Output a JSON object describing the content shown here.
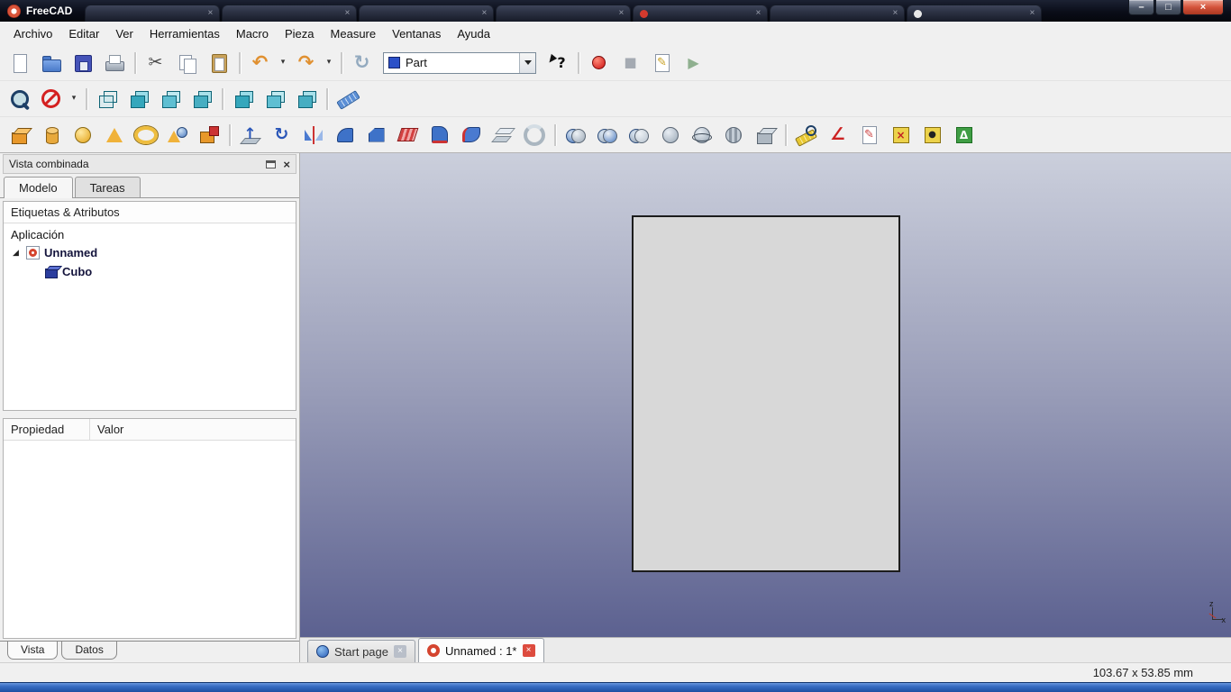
{
  "window": {
    "title": "FreeCAD",
    "controls": {
      "minimize": "–",
      "maximize": "□",
      "close": "×"
    },
    "ghost_tabs": [
      {
        "close": "×"
      },
      {
        "close": "×"
      },
      {
        "close": "×"
      },
      {
        "close": "×"
      },
      {
        "close": "×",
        "favstyle": "background:#d43a2e"
      },
      {
        "close": "×"
      },
      {
        "close": "×",
        "favstyle": "background:#e8e8e8"
      }
    ]
  },
  "menubar": {
    "items": [
      {
        "label": "Archivo",
        "name": "menu-archivo"
      },
      {
        "label": "Editar",
        "name": "menu-editar"
      },
      {
        "label": "Ver",
        "name": "menu-ver"
      },
      {
        "label": "Herramientas",
        "name": "menu-herramientas"
      },
      {
        "label": "Macro",
        "name": "menu-macro"
      },
      {
        "label": "Pieza",
        "name": "menu-pieza"
      },
      {
        "label": "Measure",
        "name": "menu-measure"
      },
      {
        "label": "Ventanas",
        "name": "menu-ventanas"
      },
      {
        "label": "Ayuda",
        "name": "menu-ayuda"
      }
    ]
  },
  "toolbars": {
    "workbench": {
      "value": "Part"
    },
    "row1a": [
      {
        "name": "new-file-button",
        "icon": "new-file-icon",
        "wcls": "tbtn",
        "cls": "tbi s-page",
        "glyph": "",
        "style": "",
        "inter": "true"
      },
      {
        "name": "open-file-button",
        "icon": "open-folder-icon",
        "wcls": "tbtn",
        "cls": "tbi s-folder",
        "glyph": "",
        "style": "",
        "inter": "true"
      },
      {
        "name": "save-button",
        "icon": "save-icon",
        "wcls": "tbtn",
        "cls": "tbi s-save",
        "glyph": "",
        "style": "",
        "inter": "true"
      },
      {
        "name": "print-button",
        "icon": "print-icon",
        "wcls": "tbtn",
        "cls": "tbi s-print",
        "glyph": "",
        "style": "",
        "inter": "true"
      },
      {
        "name": "toolbar-separator",
        "icon": "separator-line",
        "wcls": "tsepw",
        "cls": "tsep",
        "glyph": "",
        "style": "",
        "inter": "false"
      },
      {
        "name": "cut-button",
        "icon": "scissors-icon",
        "wcls": "tbtn",
        "cls": "tbi",
        "glyph": "✂",
        "style": "color:#4a4a4a;font-size:19px",
        "inter": "true"
      },
      {
        "name": "copy-button",
        "icon": "copy-icon",
        "wcls": "tbtn",
        "cls": "tbi s-copy",
        "glyph": "",
        "style": "",
        "inter": "true"
      },
      {
        "name": "paste-button",
        "icon": "paste-icon",
        "wcls": "tbtn",
        "cls": "tbi s-paste",
        "glyph": "",
        "style": "",
        "inter": "true"
      },
      {
        "name": "toolbar-separator",
        "icon": "separator-line",
        "wcls": "tsepw",
        "cls": "tsep",
        "glyph": "",
        "style": "",
        "inter": "false"
      },
      {
        "name": "undo-button",
        "icon": "undo-icon",
        "wcls": "tbtn",
        "cls": "tbi",
        "glyph": "↶",
        "style": "color:#e09030;font-size:21px;font-weight:bold",
        "inter": "true"
      },
      {
        "name": "undo-dropdown",
        "icon": "chevron-down-icon",
        "wcls": "tbtn narrow",
        "cls": "tbi s-dd",
        "glyph": "▾",
        "style": "",
        "inter": "true"
      },
      {
        "name": "redo-button",
        "icon": "redo-icon",
        "wcls": "tbtn",
        "cls": "tbi",
        "glyph": "↷",
        "style": "color:#e09030;font-size:21px;font-weight:bold",
        "inter": "true"
      },
      {
        "name": "redo-dropdown",
        "icon": "chevron-down-icon",
        "wcls": "tbtn narrow",
        "cls": "tbi s-dd",
        "glyph": "▾",
        "style": "",
        "inter": "true"
      },
      {
        "name": "toolbar-separator",
        "icon": "separator-line",
        "wcls": "tsepw",
        "cls": "tsep",
        "glyph": "",
        "style": "",
        "inter": "false"
      },
      {
        "name": "refresh-button",
        "icon": "refresh-icon",
        "wcls": "tbtn",
        "cls": "tbi",
        "glyph": "↻",
        "style": "color:#93aabf;font-size:21px;font-weight:bold",
        "inter": "true"
      }
    ],
    "row1b": [
      {
        "name": "whats-this-button",
        "icon": "help-cursor-icon",
        "wcls": "tbtn",
        "cls": "tbi s-what",
        "glyph": "?",
        "style": "color:#101010;font-weight:bold;font-size:16px",
        "inter": "true"
      },
      {
        "name": "toolbar-separator",
        "icon": "separator-line",
        "wcls": "tsepw",
        "cls": "tsep",
        "glyph": "",
        "style": "",
        "inter": "false"
      },
      {
        "name": "macro-record-button",
        "icon": "record-icon",
        "wcls": "tbtn",
        "cls": "tbi s-dot",
        "glyph": "",
        "style": "",
        "inter": "true"
      },
      {
        "name": "macro-stop-button",
        "icon": "stop-icon",
        "wcls": "tbtn",
        "cls": "tbi",
        "glyph": "■",
        "style": "color:#a4aab2;font-size:15px",
        "inter": "true"
      },
      {
        "name": "macro-edit-button",
        "icon": "edit-macro-icon",
        "wcls": "tbtn",
        "cls": "tbi s-medit",
        "glyph": "✎",
        "style": "",
        "inter": "true"
      },
      {
        "name": "macro-execute-button",
        "icon": "play-icon",
        "wcls": "tbtn",
        "cls": "tbi",
        "glyph": "▶",
        "style": "color:#8fb08f;font-size:16px",
        "inter": "true"
      }
    ],
    "row2": [
      {
        "name": "view-fit-all-button",
        "icon": "zoom-fit-icon",
        "wcls": "tbtn",
        "cls": "tbi s-zoom",
        "glyph": "",
        "style": "",
        "inter": "true"
      },
      {
        "name": "draw-style-button",
        "icon": "draw-style-icon",
        "wcls": "tbtn",
        "cls": "tbi s-nodraw",
        "glyph": "",
        "style": "",
        "inter": "true"
      },
      {
        "name": "draw-style-dropdown",
        "icon": "chevron-down-icon",
        "wcls": "tbtn narrow",
        "cls": "tbi s-dd",
        "glyph": "▾",
        "style": "",
        "inter": "true"
      },
      {
        "name": "toolbar-separator",
        "icon": "separator-line",
        "wcls": "tsepw",
        "cls": "tsep",
        "glyph": "",
        "style": "",
        "inter": "false"
      },
      {
        "name": "view-axonometric-button",
        "icon": "axonometric-cube-icon",
        "wcls": "tbtn",
        "cls": "tbi s-vcube",
        "glyph": "",
        "style": "--f:rgba(160,220,232,.25);--f2:rgba(160,220,232,.12)",
        "inter": "true"
      },
      {
        "name": "view-front-button",
        "icon": "front-view-icon",
        "wcls": "tbtn",
        "cls": "tbi s-vcube",
        "glyph": "",
        "style": "--f:#35a7bc;--f2:#9adce8",
        "inter": "true"
      },
      {
        "name": "view-top-button",
        "icon": "top-view-icon",
        "wcls": "tbtn",
        "cls": "tbi s-vcube",
        "glyph": "",
        "style": "--f:#5fbfd2;--f2:#bfe9f0",
        "inter": "true"
      },
      {
        "name": "view-right-button",
        "icon": "right-view-icon",
        "wcls": "tbtn",
        "cls": "tbi s-vcube",
        "glyph": "",
        "style": "--f:#47aec2;--f2:#a8e0ea",
        "inter": "true"
      },
      {
        "name": "toolbar-separator",
        "icon": "separator-line",
        "wcls": "tsepw",
        "cls": "tsep",
        "glyph": "",
        "style": "",
        "inter": "false"
      },
      {
        "name": "view-rear-button",
        "icon": "rear-view-icon",
        "wcls": "tbtn",
        "cls": "tbi s-vcube",
        "glyph": "",
        "style": "--f:#35a7bc;--f2:#9adce8",
        "inter": "true"
      },
      {
        "name": "view-bottom-button",
        "icon": "bottom-view-icon",
        "wcls": "tbtn",
        "cls": "tbi s-vcube",
        "glyph": "",
        "style": "--f:#5fbfd2;--f2:#bfe9f0",
        "inter": "true"
      },
      {
        "name": "view-left-button",
        "icon": "left-view-icon",
        "wcls": "tbtn",
        "cls": "tbi s-vcube",
        "glyph": "",
        "style": "--f:#47aec2;--f2:#a8e0ea",
        "inter": "true"
      },
      {
        "name": "toolbar-separator",
        "icon": "separator-line",
        "wcls": "tsepw",
        "cls": "tsep",
        "glyph": "",
        "style": "",
        "inter": "false"
      },
      {
        "name": "measure-distance-button",
        "icon": "ruler-icon",
        "wcls": "tbtn",
        "cls": "tbi s-ruler",
        "glyph": "",
        "style": "",
        "inter": "true"
      }
    ],
    "row3": [
      {
        "name": "part-box-button",
        "icon": "box-primitive-icon",
        "wcls": "tbtn",
        "cls": "tbi s-cube",
        "glyph": "",
        "style": "--c:#e8982a;--c2:#f7c268",
        "inter": "true"
      },
      {
        "name": "part-cylinder-button",
        "icon": "cylinder-primitive-icon",
        "wcls": "tbtn",
        "cls": "tbi s-cyl",
        "glyph": "",
        "style": "",
        "inter": "true"
      },
      {
        "name": "part-sphere-button",
        "icon": "sphere-primitive-icon",
        "wcls": "tbtn",
        "cls": "tbi s-sphere",
        "glyph": "",
        "style": "",
        "inter": "true"
      },
      {
        "name": "part-cone-button",
        "icon": "cone-primitive-icon",
        "wcls": "tbtn",
        "cls": "tbi s-cone",
        "glyph": "",
        "style": "",
        "inter": "true"
      },
      {
        "name": "part-torus-button",
        "icon": "torus-primitive-icon",
        "wcls": "tbtn",
        "cls": "tbi s-torus",
        "glyph": "",
        "style": "",
        "inter": "true"
      },
      {
        "name": "part-primitives-button",
        "icon": "primitives-icon",
        "wcls": "tbtn",
        "cls": "tbi s-prims",
        "glyph": "",
        "style": "",
        "inter": "true"
      },
      {
        "name": "part-shape-builder-button",
        "icon": "shape-builder-icon",
        "wcls": "tbtn",
        "cls": "tbi s-builder",
        "glyph": "",
        "style": "",
        "inter": "true"
      },
      {
        "name": "toolbar-separator",
        "icon": "separator-line",
        "wcls": "tsepw",
        "cls": "tsep",
        "glyph": "",
        "style": "",
        "inter": "false"
      },
      {
        "name": "part-extrude-button",
        "icon": "extrude-icon",
        "wcls": "tbtn",
        "cls": "tbi s-extrude",
        "glyph": "↑",
        "style": "color:#2a56b8;font-weight:bold;font-size:17px",
        "inter": "true"
      },
      {
        "name": "part-revolve-button",
        "icon": "revolve-icon",
        "wcls": "tbtn",
        "cls": "tbi",
        "glyph": "↻",
        "style": "color:#2a56b8;font-weight:bold;font-size:19px",
        "inter": "true"
      },
      {
        "name": "part-mirror-button",
        "icon": "mirror-icon",
        "wcls": "tbtn",
        "cls": "tbi s-mirror",
        "glyph": "",
        "style": "",
        "inter": "true"
      },
      {
        "name": "part-fillet-button",
        "icon": "fillet-icon",
        "wcls": "tbtn",
        "cls": "tbi s-fillet",
        "glyph": "",
        "style": "",
        "inter": "true"
      },
      {
        "name": "part-chamfer-button",
        "icon": "chamfer-icon",
        "wcls": "tbtn",
        "cls": "tbi s-chamfer",
        "glyph": "",
        "style": "",
        "inter": "true"
      },
      {
        "name": "part-ruled-surface-button",
        "icon": "ruled-surface-icon",
        "wcls": "tbtn",
        "cls": "tbi s-ruled",
        "glyph": "",
        "style": "",
        "inter": "true"
      },
      {
        "name": "part-loft-button",
        "icon": "loft-icon",
        "wcls": "tbtn",
        "cls": "tbi s-loft",
        "glyph": "",
        "style": "",
        "inter": "true"
      },
      {
        "name": "part-sweep-button",
        "icon": "sweep-icon",
        "wcls": "tbtn",
        "cls": "tbi s-sweep",
        "glyph": "",
        "style": "",
        "inter": "true"
      },
      {
        "name": "part-offset-button",
        "icon": "offset-icon",
        "wcls": "tbtn",
        "cls": "tbi s-offset",
        "glyph": "",
        "style": "",
        "inter": "true"
      },
      {
        "name": "part-thickness-button",
        "icon": "thickness-icon",
        "wcls": "tbtn",
        "cls": "tbi s-thick",
        "glyph": "",
        "style": "",
        "inter": "true"
      },
      {
        "name": "toolbar-separator",
        "icon": "separator-line",
        "wcls": "tsepw",
        "cls": "tsep",
        "glyph": "",
        "style": "",
        "inter": "false"
      },
      {
        "name": "part-boolean-button",
        "icon": "boolean-icon",
        "wcls": "tbtn",
        "cls": "tbi s-ball2",
        "glyph": "",
        "style": "--c:#3f6fb5;--c2:#9aa7b5",
        "inter": "true"
      },
      {
        "name": "part-cut-button",
        "icon": "boolean-cut-icon",
        "wcls": "tbtn",
        "cls": "tbi s-ball2",
        "glyph": "",
        "style": "--c:#9aa7b5;--c2:#4a7ac0",
        "inter": "true"
      },
      {
        "name": "part-union-button",
        "icon": "boolean-union-icon",
        "wcls": "tbtn",
        "cls": "tbi s-ball2",
        "glyph": "",
        "style": "--c:#8f9cab;--c2:#b9c4cf",
        "inter": "true"
      },
      {
        "name": "part-common-button",
        "icon": "boolean-common-icon",
        "wcls": "tbtn",
        "cls": "tbi s-ball",
        "glyph": "",
        "style": "--c:#9aa7b5",
        "inter": "true"
      },
      {
        "name": "part-section-button",
        "icon": "section-icon",
        "wcls": "tbtn",
        "cls": "tbi s-ballring",
        "glyph": "",
        "style": "",
        "inter": "true"
      },
      {
        "name": "part-cross-sections-button",
        "icon": "cross-sections-icon",
        "wcls": "tbtn",
        "cls": "tbi s-slices",
        "glyph": "",
        "style": "",
        "inter": "true"
      },
      {
        "name": "part-compound-button",
        "icon": "compound-icon",
        "wcls": "tbtn",
        "cls": "tbi s-cube",
        "glyph": "",
        "style": "--c:#aeb8c2;--c2:#d5dde4;--b:#5a6570",
        "inter": "true"
      },
      {
        "name": "toolbar-separator",
        "icon": "separator-line",
        "wcls": "tsepw",
        "cls": "tsep",
        "glyph": "",
        "style": "",
        "inter": "false"
      },
      {
        "name": "measure-linear-button",
        "icon": "measure-linear-icon",
        "wcls": "tbtn",
        "cls": "tbi s-mlin",
        "glyph": "",
        "style": "",
        "inter": "true"
      },
      {
        "name": "measure-angular-button",
        "icon": "measure-angular-icon",
        "wcls": "tbtn",
        "cls": "tbi",
        "glyph": "∠",
        "style": "color:#cc2222;font-weight:bold;font-size:19px",
        "inter": "true"
      },
      {
        "name": "measure-refresh-button",
        "icon": "measure-refresh-icon",
        "wcls": "tbtn",
        "cls": "tbi s-medit",
        "glyph": "✎",
        "style": "color:#cc4444",
        "inter": "true"
      },
      {
        "name": "measure-clear-all-button",
        "icon": "measure-clear-icon",
        "wcls": "tbtn",
        "cls": "tbi s-mbox",
        "glyph": "×",
        "style": "color:#c22222;font-weight:bold",
        "inter": "true"
      },
      {
        "name": "measure-toggle-all-button",
        "icon": "measure-toggle-icon",
        "wcls": "tbtn",
        "cls": "tbi s-mbox",
        "glyph": "●",
        "style": "color:#222222;font-size:10px",
        "inter": "true"
      },
      {
        "name": "measure-toggle-delta-button",
        "icon": "measure-delta-icon",
        "wcls": "tbtn",
        "cls": "tbi s-mgreen",
        "glyph": "Δ",
        "style": "color:#ffffff;font-weight:bold",
        "inter": "true"
      }
    ]
  },
  "combo_view": {
    "title": "Vista combinada",
    "close_glyph": "×",
    "tabs": {
      "model": "Modelo",
      "tasks": "Tareas"
    },
    "tree_header": "Etiquetas & Atributos",
    "tree": {
      "root": "Aplicación",
      "expander": "◢",
      "document": "Unnamed",
      "object": "Cubo"
    },
    "properties": {
      "col1": "Propiedad",
      "col2": "Valor"
    },
    "bottom_tabs": {
      "view": "Vista",
      "data": "Datos"
    }
  },
  "viewport": {
    "tabs": [
      {
        "label": "Start page",
        "close": "×"
      },
      {
        "label": "Unnamed : 1*",
        "close": "×"
      }
    ],
    "axis": {
      "x": "x",
      "z": "z"
    }
  },
  "statusbar": {
    "dimensions": "103.67 x 53.85 mm"
  }
}
